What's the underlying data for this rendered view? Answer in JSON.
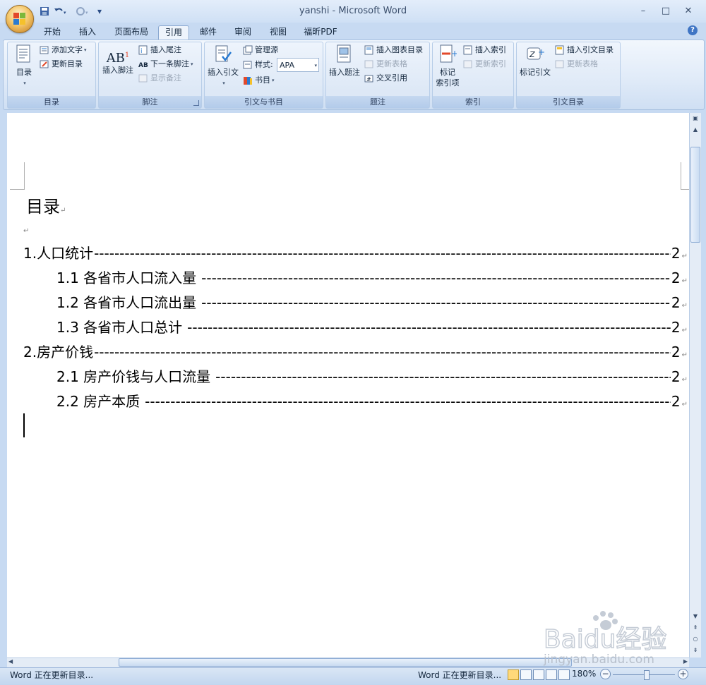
{
  "window": {
    "title": "yanshi - Microsoft Word",
    "minimize": "–",
    "maximize": "□",
    "close": "✕"
  },
  "qat": {
    "save": "save-icon",
    "undo": "undo-icon",
    "redo": "redo-icon",
    "more": "▾"
  },
  "tabs": [
    "开始",
    "插入",
    "页面布局",
    "引用",
    "邮件",
    "审阅",
    "视图",
    "福昕PDF"
  ],
  "active_tab": "引用",
  "ribbon": {
    "groups": {
      "toc": {
        "label": "目录",
        "big": "目录",
        "add_text": "添加文字",
        "update_toc": "更新目录"
      },
      "footnotes": {
        "label": "脚注",
        "big": "插入脚注",
        "big_icon_text": "AB",
        "insert_endnote": "插入尾注",
        "next_footnote": "下一条脚注",
        "show_notes": "显示备注"
      },
      "citations": {
        "label": "引文与书目",
        "big": "插入引文",
        "manage_sources": "管理源",
        "style_label": "样式:",
        "style_value": "APA",
        "bibliography": "书目"
      },
      "captions": {
        "label": "题注",
        "big": "插入题注",
        "insert_tof": "插入图表目录",
        "update_table": "更新表格",
        "cross_ref": "交叉引用"
      },
      "index": {
        "label": "索引",
        "big_line1": "标记",
        "big_line2": "索引项",
        "insert_index": "插入索引",
        "update_index": "更新索引"
      },
      "toa": {
        "label": "引文目录",
        "big": "标记引文",
        "insert_toa": "插入引文目录",
        "update_table": "更新表格"
      }
    }
  },
  "document": {
    "heading": "目录",
    "empty_mark": "↵",
    "toc": [
      {
        "text": "1.人口统计",
        "page": "2",
        "level": 1
      },
      {
        "text": "1.1 各省市人口流入量",
        "page": "2",
        "level": 2
      },
      {
        "text": "1.2 各省市人口流出量",
        "page": "2",
        "level": 2
      },
      {
        "text": "1.3 各省市人口总计",
        "page": "2",
        "level": 2
      },
      {
        "text": "2.房产价钱",
        "page": "2",
        "level": 1
      },
      {
        "text": "2.1 房产价钱与人口流量",
        "page": "2",
        "level": 2
      },
      {
        "text": "2.2 房产本质",
        "page": "2",
        "level": 2
      }
    ]
  },
  "status": {
    "left": "Word 正在更新目录...",
    "right": "Word 正在更新目录...",
    "zoom": "180%",
    "zoom_minus": "−",
    "zoom_plus": "+"
  },
  "watermark": {
    "brand": "Baidu经验",
    "url": "jingyan.baidu.com"
  },
  "colors": {
    "ribbon_bg": "#dfeaf8",
    "accent": "#3f75c4",
    "page": "#ffffff"
  }
}
